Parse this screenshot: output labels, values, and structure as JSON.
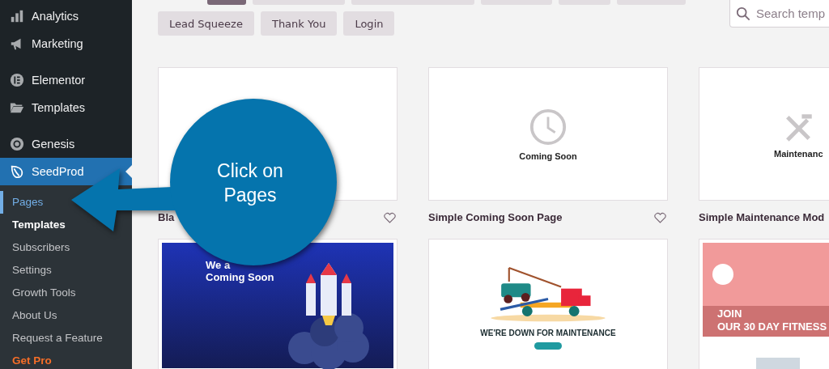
{
  "sidebar": {
    "menu": [
      {
        "label": "Analytics",
        "selected": false
      },
      {
        "label": "Marketing",
        "selected": false
      },
      {
        "label": "Elementor",
        "selected": false
      },
      {
        "label": "Templates",
        "selected": false
      },
      {
        "label": "Genesis",
        "selected": false
      },
      {
        "label": "SeedProd",
        "selected": true
      }
    ],
    "submenu": [
      {
        "label": "Pages",
        "selected": true,
        "kind": "link"
      },
      {
        "label": "Templates",
        "selected": false,
        "kind": "strong"
      },
      {
        "label": "Subscribers",
        "selected": false,
        "kind": "link"
      },
      {
        "label": "Settings",
        "selected": false,
        "kind": "link"
      },
      {
        "label": "Growth Tools",
        "selected": false,
        "kind": "link"
      },
      {
        "label": "About Us",
        "selected": false,
        "kind": "link"
      },
      {
        "label": "Request a Feature",
        "selected": false,
        "kind": "link"
      },
      {
        "label": "Get Pro",
        "selected": false,
        "kind": "upgrade"
      }
    ]
  },
  "filter_tabs": [
    {
      "selected": true
    },
    {
      "selected": false
    },
    {
      "selected": false
    },
    {
      "selected": false
    },
    {
      "selected": false
    },
    {
      "selected": false
    }
  ],
  "filter_buttons": [
    {
      "label": "Lead Squeeze"
    },
    {
      "label": "Thank You"
    },
    {
      "label": "Login"
    }
  ],
  "search": {
    "placeholder": "Search temp"
  },
  "templates": [
    {
      "kind": "blank",
      "title": "Bla",
      "favorite": false
    },
    {
      "kind": "coming-soon",
      "title": "Simple Coming Soon Page",
      "favorite": false,
      "headline": "Coming Soon"
    },
    {
      "kind": "maintenance",
      "title": "Simple Maintenance Mod",
      "headline": "Maintenanc"
    },
    {
      "kind": "rocket",
      "headline": "We a",
      "subheadline": "Coming Soon"
    },
    {
      "kind": "tow-truck",
      "headline": "WE'RE DOWN FOR MAINTENANCE"
    },
    {
      "kind": "fitness",
      "headline": "JOIN",
      "subheadline": "OUR 30 DAY FITNESS"
    }
  ],
  "callout": {
    "text": "Click on Pages"
  }
}
